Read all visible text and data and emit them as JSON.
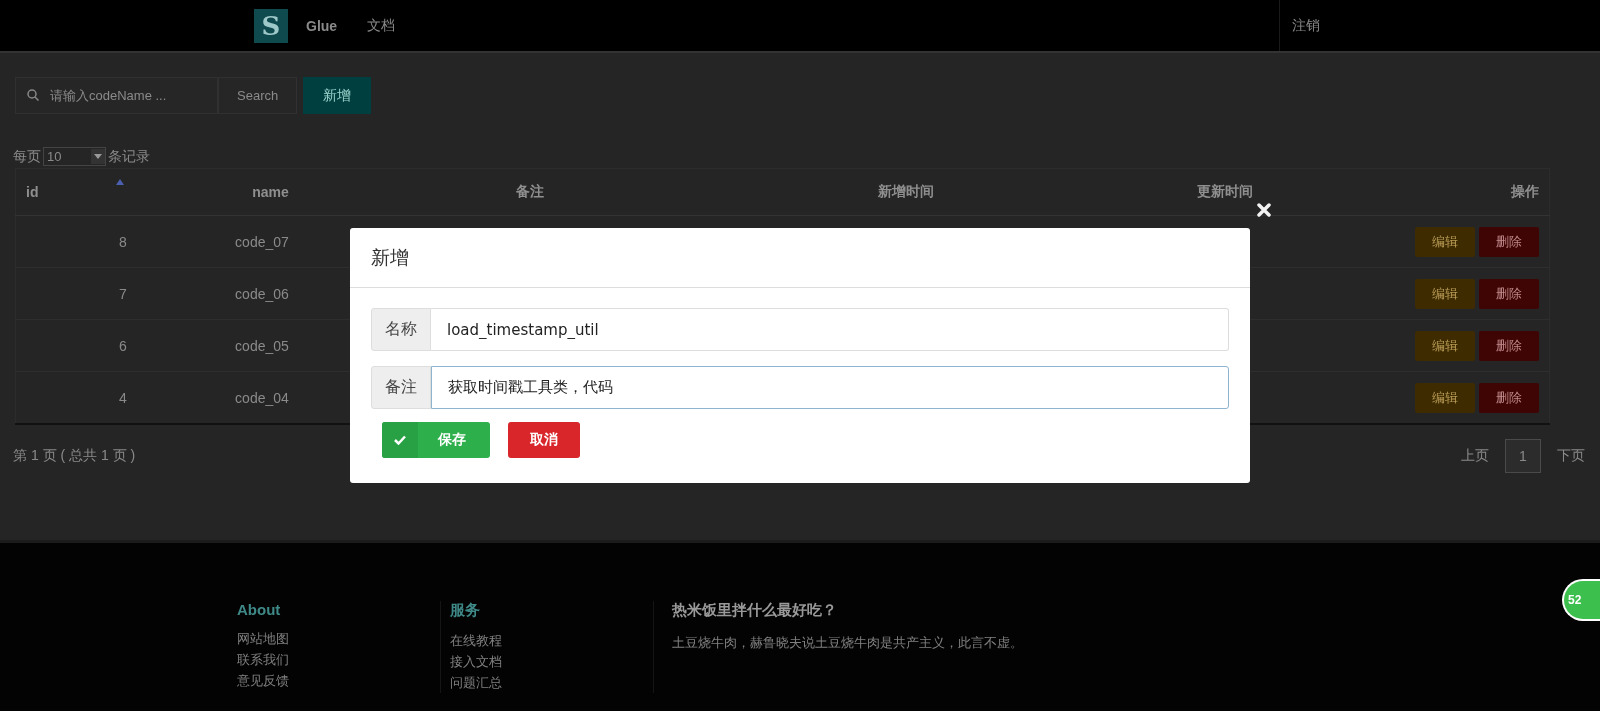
{
  "nav": {
    "logo": "S",
    "items": [
      {
        "label": "Glue",
        "selected": true
      },
      {
        "label": "文档",
        "selected": false
      }
    ],
    "logout": "注销"
  },
  "toolbar": {
    "search": {
      "placeholder": "请输入codeName ..."
    },
    "search_button": "Search",
    "add_button": "新增"
  },
  "page_size": {
    "prefix": "每页",
    "value": "10",
    "suffix": "条记录"
  },
  "table": {
    "columns": [
      {
        "label": "id",
        "sorted": true
      },
      {
        "label": "name",
        "sorted": false
      },
      {
        "label": "备注",
        "sorted": false
      },
      {
        "label": "新增时间",
        "sorted": false
      },
      {
        "label": "更新时间",
        "sorted": false
      },
      {
        "label": "操作",
        "sorted": false
      }
    ],
    "rows": [
      {
        "id": "8",
        "name": "code_07",
        "actions": [
          "编辑",
          "删除"
        ]
      },
      {
        "id": "7",
        "name": "code_06",
        "actions": [
          "编辑",
          "删除"
        ]
      },
      {
        "id": "6",
        "name": "code_05",
        "actions": [
          "编辑",
          "删除"
        ]
      },
      {
        "id": "4",
        "name": "code_04",
        "actions": [
          "编辑",
          "删除"
        ]
      }
    ]
  },
  "pager": {
    "summary": "第 1 页 ( 总共 1 页 )",
    "prev": "上页",
    "pages": [
      {
        "label": "1",
        "selected": true
      }
    ],
    "next": "下页"
  },
  "modal": {
    "title": "新增",
    "fields": [
      {
        "label": "名称",
        "value": "load_timestamp_util",
        "focused": false
      },
      {
        "label": "备注",
        "value": "获取时间戳工具类，代码",
        "focused": true
      }
    ],
    "buttons": [
      {
        "kind": "save",
        "label": "保存"
      },
      {
        "kind": "cancel",
        "label": "取消"
      }
    ]
  },
  "footer": {
    "columns": [
      {
        "title": "About",
        "links": [
          "网站地图",
          "联系我们",
          "意见反馈"
        ]
      },
      {
        "title": "服务",
        "links": [
          "在线教程",
          "接入文档",
          "问题汇总"
        ]
      }
    ],
    "article": {
      "title": "热米饭里拌什么最好吃？",
      "text": "土豆烧牛肉，赫鲁晓夫说土豆烧牛肉是共产主义，此言不虚。"
    },
    "badge": "52"
  }
}
